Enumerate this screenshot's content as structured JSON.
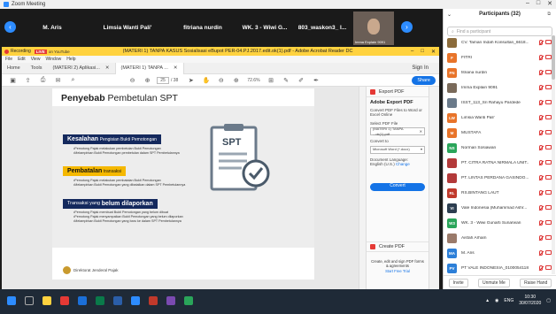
{
  "zoom": {
    "title": "Zoom Meeting",
    "video_tiles": [
      "M. Aris",
      "Limsia Wanti Pali'",
      "fitriana nurdin",
      "WK. 3 - Wiwi G...",
      "803_waskon3_ I..."
    ],
    "cam_label": "Imma Explain 9091"
  },
  "acrobat": {
    "recording": "Recording",
    "live": "LIVE",
    "live_service": "on YouTube",
    "window_title": "(MATERI 1) TANPA KASUS Sosialisasi eBupot PER-04.PJ.2017.edit.ok(1).pdf - Adobe Acrobat Reader DC",
    "menu": [
      "File",
      "Edit",
      "View",
      "Window",
      "Help"
    ],
    "tabs": [
      "Home",
      "Tools",
      "(MATERI 2) Aplikasi...",
      "(MATERI 1) TANPA ..."
    ],
    "sign_in": "Sign In",
    "page_current": "25",
    "page_total": "/ 38",
    "zoom": "72.6%",
    "share": "Share"
  },
  "slide": {
    "title_bold": "Penyebab",
    "title_rest": "Pembetulan SPT",
    "sections": [
      {
        "head_bold": "Kesalahan",
        "head_rest": "Pengisian Bukti Pemotongan",
        "bullets": [
          "Pemotong Pajak melakukan pembetulan Bukti Pemotongan",
          "Melampirkan Bukti Pemotongan pembetulan dalam SPT Pembetulannya"
        ]
      },
      {
        "head_bold": "Pembatalan",
        "head_rest": "transaksi",
        "bullets": [
          "Pemotong Pajak melakukan pembatalan Bukti Pemotongan",
          "Melampirkan Bukti Pemotongan yang dibatalkan dalam SPT Pembetulannya"
        ]
      },
      {
        "head_rest_pre": "Transaksi yang",
        "head_bold": "belum dilaporkan",
        "bullets": [
          "Pemotong Pajak membuat Bukti Pemotongan yang belum dibuat",
          "Pemotong Pajak menyampaikan Bukti Pemotongan yang belum dilaporkan",
          "Melampirkan Bukti Pemotongan yang baru ke dalam SPT Pembetulannya"
        ]
      }
    ],
    "doc_label": "SPT",
    "footer": "Direktorat Jenderal Pajak"
  },
  "right_pane": {
    "export_pdf": "Export PDF",
    "heading": "Adobe Export PDF",
    "desc": "Convert PDF Files to Word or Excel Online",
    "select_label": "Select PDF File",
    "file": "(MATERI 1) TANPA ...ok(1).pdf",
    "convert_to": "Convert to",
    "format": "Microsoft Word (*.docx)",
    "doc_lang_label": "Document Language:",
    "doc_lang": "English (U.S.)",
    "change": "Change",
    "convert": "Convert",
    "create_pdf": "Create PDF",
    "promo": "Create, edit and sign PDF forms & agreements",
    "trial": "Start Free Trial"
  },
  "participants": {
    "title": "Participants (32)",
    "search_placeholder": "Find a participant",
    "items": [
      {
        "initials": "",
        "name": "CV. Taman Indah Konsultan_6618...",
        "color": "#8b6b3b"
      },
      {
        "initials": "F",
        "name": "FITRI",
        "color": "#e8742a"
      },
      {
        "initials": "FN",
        "name": "fitriana nurdin",
        "color": "#e8742a"
      },
      {
        "initials": "",
        "name": "Imma Explain 9091",
        "color": "#7a6a5a"
      },
      {
        "initials": "",
        "name": "ISST_113_Sri Rahayu Pardede",
        "color": "#6a7a8a"
      },
      {
        "initials": "LW",
        "name": "Limsia Wanti Pali'",
        "color": "#e8742a"
      },
      {
        "initials": "M",
        "name": "MUSTAFA",
        "color": "#e8742a"
      },
      {
        "initials": "NS",
        "name": "Norman Sosiawan",
        "color": "#2aa55a"
      },
      {
        "initials": "",
        "name": "PT. CITRA RATNA NIRMALA UNIT...",
        "color": "#b33a3a"
      },
      {
        "initials": "",
        "name": "PT. LINTAS PERDANA GASINDO...",
        "color": "#b33a3a"
      },
      {
        "initials": "RL",
        "name": "RS.BINTANG LAUT",
        "color": "#c0392b"
      },
      {
        "initials": "VI",
        "name": "Vale Indonesia (Muhammad Ashr...",
        "color": "#2c3e50"
      },
      {
        "initials": "W3",
        "name": "WK. 3 - Wiwi Gunarti Sunarwan",
        "color": "#2aa55a"
      },
      {
        "initials": "",
        "name": "Aisfah Arham",
        "color": "#9a7a6a"
      },
      {
        "initials": "MA",
        "name": "M. Aris",
        "color": "#2c7fd8"
      },
      {
        "initials": "PV",
        "name": "PT VALE INDONESIA_01000541180...",
        "color": "#2c7fd8"
      }
    ],
    "invite": "Invite",
    "unmute_me": "Unmute Me",
    "raise_hand": "Raise Hand"
  },
  "taskbar": {
    "lang": "ENG",
    "time": "10:30",
    "date": "30/07/2020"
  },
  "colors": {
    "zoom_blue": "#2d8cff",
    "acrobat_yellow": "#ffd23f",
    "acrobat_blue": "#1473e6",
    "navy": "#14295d",
    "gold": "#f5b800"
  }
}
